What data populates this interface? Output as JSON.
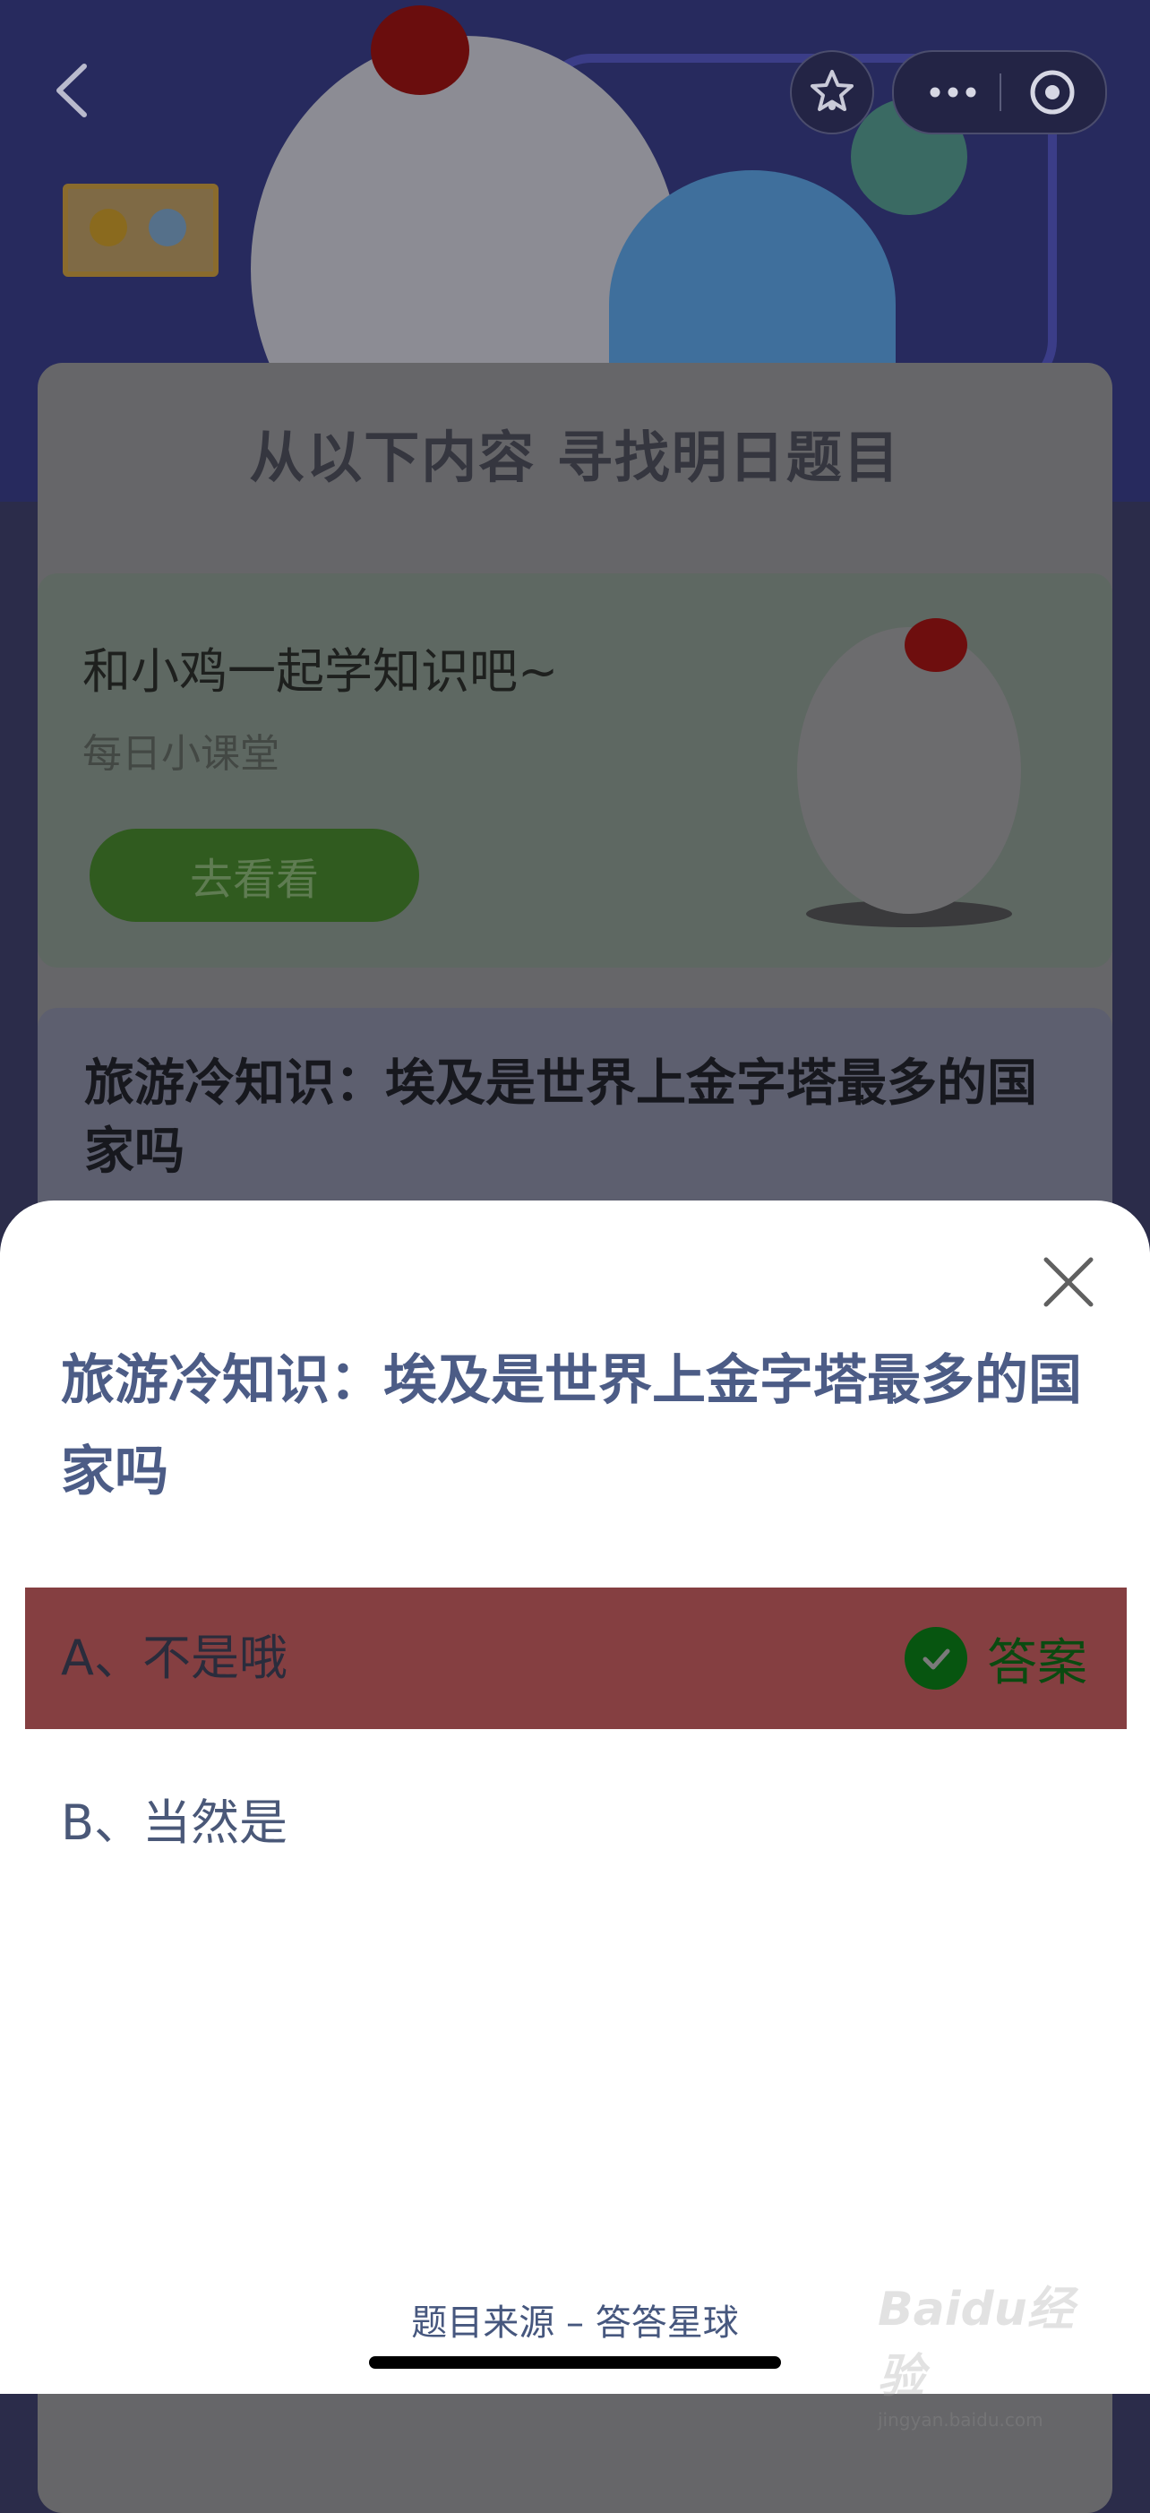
{
  "background": {
    "banner_title": "从以下内容 寻找明日题目",
    "learn_card": {
      "title": "和小鸡一起学知识吧~",
      "subtitle": "每日小课堂",
      "button": "去看看"
    },
    "question_card_title": "旅游冷知识：埃及是世界上金字塔最多的国家吗"
  },
  "sheet": {
    "question": "旅游冷知识：埃及是世界上金字塔最多的国家吗",
    "options": [
      {
        "label": "A、不是哦",
        "is_answer": true
      },
      {
        "label": "B、当然是",
        "is_answer": false
      }
    ],
    "answer_label": "答案",
    "source": "题目来源 – 答答星球"
  },
  "watermark": {
    "main": "Baidu经验",
    "sub": "jingyan.baidu.com"
  },
  "colors": {
    "answer_row": "#853f41",
    "question_text": "#4c5c86",
    "answer_check": "#075510"
  },
  "icons": [
    "back-icon",
    "star-icon",
    "more-icon",
    "target-icon",
    "close-icon",
    "check-icon"
  ]
}
